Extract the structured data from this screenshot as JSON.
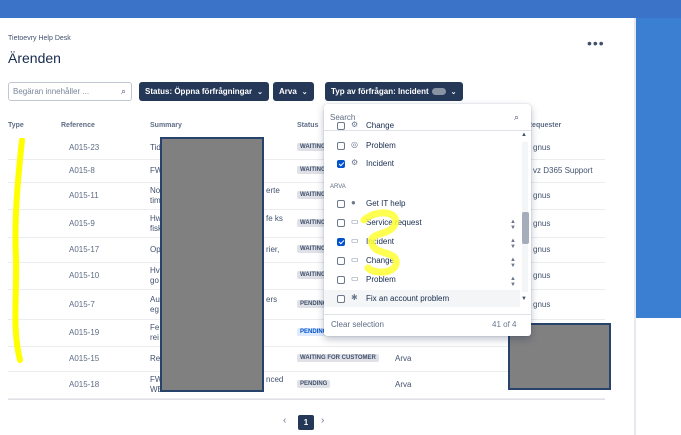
{
  "header": {
    "project_name": "Tietoevry Help Desk",
    "page_title": "Ärenden",
    "more_label": "•••"
  },
  "filters": {
    "search_placeholder": "Begäran innehåller ...",
    "status_label": "Status: Öppna förfrågningar",
    "arva_label": "Arva",
    "type_label": "Typ av förfrågan: Incident",
    "chevron": "⌄"
  },
  "table": {
    "headers": {
      "type": "Type",
      "reference": "Reference",
      "summary": "Summary",
      "status": "Status",
      "requester": "Requester"
    },
    "rows": [
      {
        "reference": "A015-23",
        "summary": "Tid",
        "status": "WAITING",
        "requester": "",
        "requester2": "gnus"
      },
      {
        "reference": "A015-8",
        "summary": "FW",
        "status": "WAITING",
        "requester": "",
        "requester2": "vz D365 Support"
      },
      {
        "reference": "A015-11",
        "summary": "No",
        "summary_extra": "erte",
        "summary_line2": "tim",
        "status": "WAITING",
        "requester": "",
        "requester2": "gnus"
      },
      {
        "reference": "A015-9",
        "summary": "Hw",
        "summary_extra": "fe ks",
        "summary_line2": "fisk",
        "status": "WAITING",
        "requester": "",
        "requester2": "gnus"
      },
      {
        "reference": "A015-17",
        "summary": "Op",
        "summary_extra": "rier,",
        "status": "WAITING",
        "requester": "",
        "requester2": "gnus"
      },
      {
        "reference": "A015-10",
        "summary": "Hv",
        "summary_line2": "go",
        "status": "WAITING",
        "requester": "",
        "requester2": "gnus"
      },
      {
        "reference": "A015-7",
        "summary": "Au",
        "summary_extra": "ers",
        "summary_line2": "eg",
        "status": "PENDING",
        "requester": "",
        "requester2": "gnus"
      },
      {
        "reference": "A015-19",
        "summary": "Fe",
        "summary_line2": "rei",
        "status": "PENDING",
        "status_blue": true,
        "requester": "",
        "requester2": ""
      },
      {
        "reference": "A015-15",
        "summary": "Re",
        "status": "WAITING FOR CUSTOMER",
        "requester": "Arva",
        "requester2": ""
      },
      {
        "reference": "A015-18",
        "summary": "FW",
        "summary_extra": "nced",
        "summary_line2": "WE",
        "status": "PENDING",
        "requester": "Arva",
        "requester2": ""
      }
    ]
  },
  "dropdown": {
    "search_placeholder": "Search",
    "group_label": "ARVA",
    "items_top": [
      {
        "label": "Change",
        "checked": false,
        "icon": "⚙"
      },
      {
        "label": "Problem",
        "checked": false,
        "icon": "◎"
      },
      {
        "label": "Incident",
        "checked": true,
        "icon": "⚙"
      }
    ],
    "items_arva": [
      {
        "label": "Get IT help",
        "checked": false,
        "icon": "●"
      },
      {
        "label": "Service request",
        "checked": false,
        "icon": "▭"
      },
      {
        "label": "Incident",
        "checked": true,
        "icon": "▭"
      },
      {
        "label": "Change",
        "checked": false,
        "icon": "▭"
      },
      {
        "label": "Problem",
        "checked": false,
        "icon": "▭"
      },
      {
        "label": "Fix an account problem",
        "checked": false,
        "icon": "✱"
      }
    ],
    "clear_label": "Clear selection",
    "count_label": "41 of 4",
    "reorder_icon": "▲▼"
  },
  "pagination": {
    "prev": "‹",
    "current": "1",
    "next": "›"
  },
  "colors": {
    "accent": "#253858",
    "brand_blue": "#3a73c8",
    "redaction": "#808080",
    "highlight": "#ffff00"
  }
}
